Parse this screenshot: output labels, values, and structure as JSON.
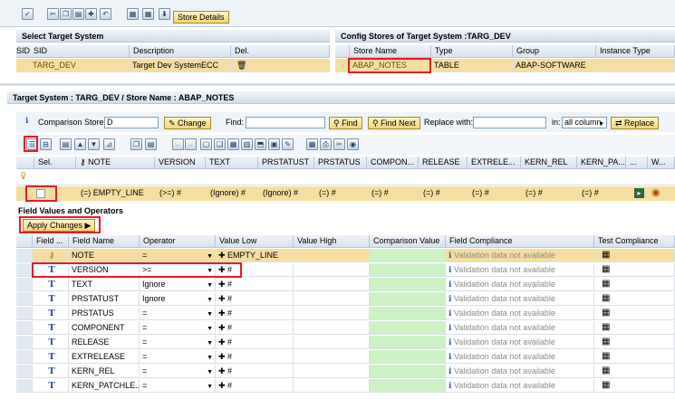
{
  "toolbar": {
    "store_details": "Store Details"
  },
  "target_system": {
    "title": "Select Target System",
    "headers": [
      "SID",
      "Description",
      "Del."
    ],
    "row": {
      "sid": "TARG_DEV",
      "description": "Target Dev SystemECC"
    }
  },
  "config_stores": {
    "title": "Config Stores of Target System :TARG_DEV",
    "headers": [
      "Store Name",
      "Type",
      "Group",
      "Instance Type"
    ],
    "row": {
      "store_name": "ABAP_NOTES",
      "type": "TABLE",
      "group": "ABAP-SOFTWARE",
      "instance_type": ""
    }
  },
  "store_panel": {
    "title": "Target System : TARG_DEV / Store Name : ABAP_NOTES",
    "comparison_label": "Comparison Store:",
    "comparison_value": "D",
    "change": "Change",
    "find_label": "Find:",
    "find": "Find",
    "find_next": "Find Next",
    "replace_label": "Replace with:",
    "in_label": "in:",
    "in_value": "all column",
    "replace": "Replace"
  },
  "grid": {
    "headers": [
      "Sel.",
      "NOTE",
      "VERSION",
      "TEXT",
      "PRSTATUST",
      "PRSTATUS",
      "COMPON...",
      "RELEASE",
      "EXTRELE...",
      "KERN_REL",
      "KERN_PA...",
      "...",
      "W..."
    ],
    "row": [
      "(=) EMPTY_LINE",
      "(>=) #",
      "(Ignore) #",
      "(Ignore) #",
      "(=) #",
      "(=) #",
      "(=) #",
      "(=) #",
      "(=) #",
      "(=) #"
    ]
  },
  "field_values": {
    "title": "Field Values and Operators",
    "apply": "Apply Changes",
    "headers": [
      "Field ...",
      "Field Name",
      "Operator",
      "Value Low",
      "Value High",
      "Comparison Value",
      "Field Compliance",
      "Test Compliance"
    ],
    "validation_text": "Validation data not available",
    "rows": [
      {
        "name": "NOTE",
        "op": "=",
        "low": "EMPTY_LINE"
      },
      {
        "name": "VERSION",
        "op": ">=",
        "low": "#"
      },
      {
        "name": "TEXT",
        "op": "Ignore",
        "low": "#"
      },
      {
        "name": "PRSTATUST",
        "op": "Ignore",
        "low": "#"
      },
      {
        "name": "PRSTATUS",
        "op": "=",
        "low": "#"
      },
      {
        "name": "COMPONENT",
        "op": "=",
        "low": "#"
      },
      {
        "name": "RELEASE",
        "op": "=",
        "low": "#"
      },
      {
        "name": "EXTRELEASE",
        "op": "=",
        "low": "#"
      },
      {
        "name": "KERN_REL",
        "op": "=",
        "low": "#"
      },
      {
        "name": "KERN_PATCHLE...",
        "op": "=",
        "low": "#"
      }
    ]
  }
}
